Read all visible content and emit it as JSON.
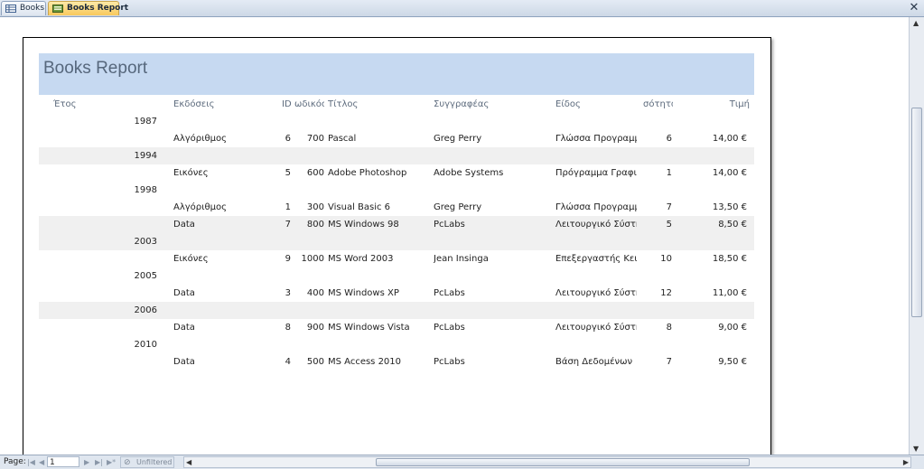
{
  "tabs": [
    {
      "label": "Books",
      "icon": "table-icon"
    },
    {
      "label": "Books Report",
      "icon": "report-icon",
      "active": true
    }
  ],
  "report": {
    "title": "Books Report",
    "headers": {
      "year": "Έτος",
      "publisher": "Εκδόσεις",
      "id": "ID",
      "code": "ωδικός",
      "title": "Τίτλος",
      "author": "Συγγραφέας",
      "genre": "Είδος",
      "qty": "σότητα",
      "price": "Τιμή"
    },
    "rows": [
      {
        "type": "group",
        "year": "1987",
        "shade": false
      },
      {
        "type": "detail",
        "publisher": "Αλγόριθμος",
        "id": "6",
        "code": "700",
        "title": "Pascal",
        "author": "Greg Perry",
        "genre": "Γλώσσα Προγραμμα",
        "qty": "6",
        "price": "14,00 €",
        "shade": false
      },
      {
        "type": "group",
        "year": "1994",
        "shade": true
      },
      {
        "type": "detail",
        "publisher": "Εικόνες",
        "id": "5",
        "code": "600",
        "title": "Adobe Photoshop",
        "author": "Adobe Systems",
        "genre": "Πρόγραμμα Γραφικ",
        "qty": "1",
        "price": "14,00 €",
        "shade": false
      },
      {
        "type": "group",
        "year": "1998",
        "shade": false
      },
      {
        "type": "detail",
        "publisher": "Αλγόριθμος",
        "id": "1",
        "code": "300",
        "title": "Visual Basic 6",
        "author": "Greg Perry",
        "genre": "Γλώσσα Προγραμμα",
        "qty": "7",
        "price": "13,50 €",
        "shade": false
      },
      {
        "type": "detail",
        "publisher": "Data",
        "id": "7",
        "code": "800",
        "title": "MS Windows 98",
        "author": "PcLabs",
        "genre": "Λειτουργικό Σύστημ",
        "qty": "5",
        "price": "8,50 €",
        "shade": true
      },
      {
        "type": "group",
        "year": "2003",
        "shade": true
      },
      {
        "type": "detail",
        "publisher": "Εικόνες",
        "id": "9",
        "code": "1000",
        "title": "MS Word 2003",
        "author": "Jean Insinga",
        "genre": "Επεξεργαστής Κειμέ",
        "qty": "10",
        "price": "18,50 €",
        "shade": false
      },
      {
        "type": "group",
        "year": "2005",
        "shade": false
      },
      {
        "type": "detail",
        "publisher": "Data",
        "id": "3",
        "code": "400",
        "title": "MS Windows XP",
        "author": "PcLabs",
        "genre": "Λειτουργικό Σύστημ",
        "qty": "12",
        "price": "11,00 €",
        "shade": false
      },
      {
        "type": "group",
        "year": "2006",
        "shade": true
      },
      {
        "type": "detail",
        "publisher": "Data",
        "id": "8",
        "code": "900",
        "title": "MS Windows Vista",
        "author": "PcLabs",
        "genre": "Λειτουργικό Σύστημ",
        "qty": "8",
        "price": "9,00 €",
        "shade": false
      },
      {
        "type": "group",
        "year": "2010",
        "shade": false
      },
      {
        "type": "detail",
        "publisher": "Data",
        "id": "4",
        "code": "500",
        "title": "MS Access 2010",
        "author": "PcLabs",
        "genre": "Βάση Δεδομένων",
        "qty": "7",
        "price": "9,50 €",
        "shade": false
      }
    ]
  },
  "navigation": {
    "page_label": "Page:",
    "page_value": "1",
    "filter_label": "Unfiltered"
  },
  "colors": {
    "title_band": "#c6d9f1",
    "active_tab": "#f8c95d",
    "row_shade": "#f0f0f0"
  }
}
